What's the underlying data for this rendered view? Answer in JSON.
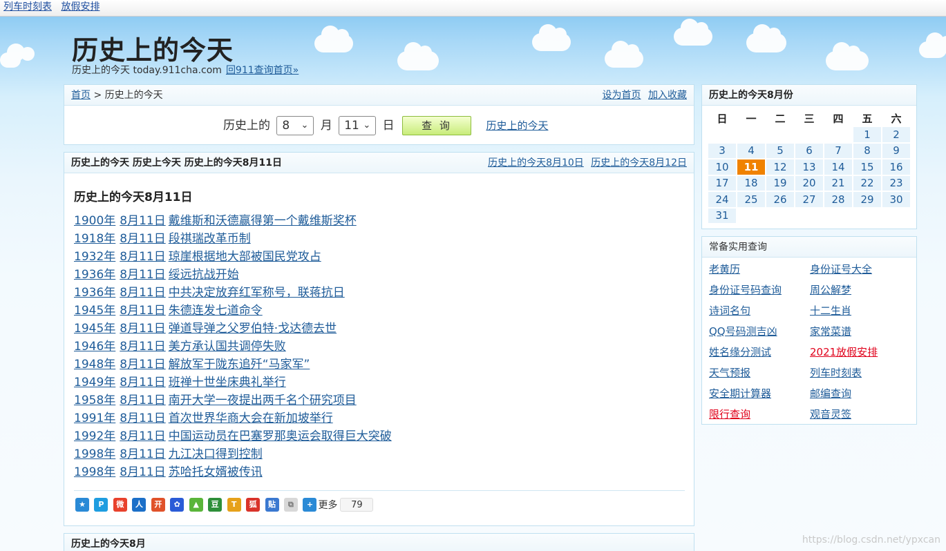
{
  "topbar": {
    "links": [
      "列车时刻表",
      "放假安排"
    ]
  },
  "header": {
    "title": "历史上的今天",
    "subtitle": "历史上的今天 today.911cha.com",
    "home_link": "回911查询首页»"
  },
  "nav": {
    "breadcrumb_home": "首页",
    "breadcrumb_sep": ">",
    "breadcrumb_current": "历史上的今天",
    "set_home": "设为首页",
    "add_fav": "加入收藏",
    "query_prefix": "历史上的",
    "month_value": "8",
    "month_unit": "月",
    "day_value": "11",
    "day_unit": "日",
    "query_button": "查 询",
    "query_link": "历史上的今天"
  },
  "events_box": {
    "header_title": "历史上的今天 历史上今天 历史上的今天8月11日",
    "prev_link": "历史上的今天8月10日",
    "next_link": "历史上的今天8月12日",
    "title": "历史上的今天8月11日",
    "events": [
      {
        "year": "1900年",
        "date": "8月11日",
        "text": "戴维斯和沃德赢得第一个戴维斯奖杯"
      },
      {
        "year": "1918年",
        "date": "8月11日",
        "text": "段祺瑞改革币制"
      },
      {
        "year": "1932年",
        "date": "8月11日",
        "text": "琼崖根据地大部被国民党攻占"
      },
      {
        "year": "1936年",
        "date": "8月11日",
        "text": "绥远抗战开始"
      },
      {
        "year": "1936年",
        "date": "8月11日",
        "text": "中共决定放弃红军称号，联蒋抗日"
      },
      {
        "year": "1945年",
        "date": "8月11日",
        "text": "朱德连发七道命令"
      },
      {
        "year": "1945年",
        "date": "8月11日",
        "text": "弹道导弹之父罗伯特·戈达德去世"
      },
      {
        "year": "1946年",
        "date": "8月11日",
        "text": "美方承认国共调停失败"
      },
      {
        "year": "1948年",
        "date": "8月11日",
        "text": "解放军于陇东追歼“马家军”"
      },
      {
        "year": "1949年",
        "date": "8月11日",
        "text": "班禅十世坐床典礼举行"
      },
      {
        "year": "1958年",
        "date": "8月11日",
        "text": "南开大学一夜提出两千名个研究项目"
      },
      {
        "year": "1991年",
        "date": "8月11日",
        "text": "首次世界华商大会在新加坡举行"
      },
      {
        "year": "1992年",
        "date": "8月11日",
        "text": "中国运动员在巴塞罗那奥运会取得巨大突破"
      },
      {
        "year": "1998年",
        "date": "8月11日",
        "text": "九江决口得到控制"
      },
      {
        "year": "1998年",
        "date": "8月11日",
        "text": "苏哈托女婿被传讯"
      }
    ],
    "share_more": "更多",
    "share_count": "79"
  },
  "month_box": {
    "title": "历史上的今天8月"
  },
  "calendar": {
    "title": "历史上的今天8月份",
    "weekdays": [
      "日",
      "一",
      "二",
      "三",
      "四",
      "五",
      "六"
    ],
    "leading_blanks": 5,
    "days_in_month": 31,
    "today": 11,
    "today_color": "#f08200"
  },
  "tools": {
    "title": "常备实用查询",
    "items": [
      {
        "label": "老黄历",
        "red": false
      },
      {
        "label": "身份证号大全",
        "red": false
      },
      {
        "label": "身份证号码查询",
        "red": false
      },
      {
        "label": "周公解梦",
        "red": false
      },
      {
        "label": "诗词名句",
        "red": false
      },
      {
        "label": "十二生肖",
        "red": false
      },
      {
        "label": "QQ号码测吉凶",
        "red": false
      },
      {
        "label": "家常菜谱",
        "red": false
      },
      {
        "label": "姓名缘分测试",
        "red": false
      },
      {
        "label": "2021放假安排",
        "red": true
      },
      {
        "label": "天气预报",
        "red": false
      },
      {
        "label": "列车时刻表",
        "red": false
      },
      {
        "label": "安全期计算器",
        "red": false
      },
      {
        "label": "邮编查询",
        "red": false
      },
      {
        "label": "限行查询",
        "red": true
      },
      {
        "label": "观音灵签",
        "red": false
      }
    ]
  },
  "watermark": "https://blog.csdn.net/ypxcan",
  "colors": {
    "link": "#1f5c99",
    "red_link": "#e0001a",
    "border": "#bfe0f0"
  }
}
